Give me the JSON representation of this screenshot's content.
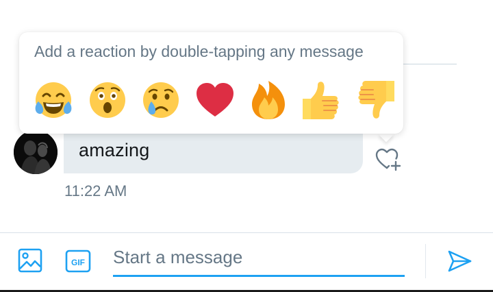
{
  "popover": {
    "hint": "Add a reaction by double-tapping any message",
    "emojis": [
      {
        "name": "tears-of-joy"
      },
      {
        "name": "surprised"
      },
      {
        "name": "crying"
      },
      {
        "name": "heart"
      },
      {
        "name": "fire"
      },
      {
        "name": "thumbs-up"
      },
      {
        "name": "thumbs-down"
      }
    ]
  },
  "message": {
    "text": "amazing",
    "timestamp": "11:22 AM"
  },
  "composer": {
    "placeholder": "Start a message"
  },
  "colors": {
    "accent": "#1da1f2",
    "bubble": "#e6ecf0",
    "muted_text": "#657786"
  }
}
